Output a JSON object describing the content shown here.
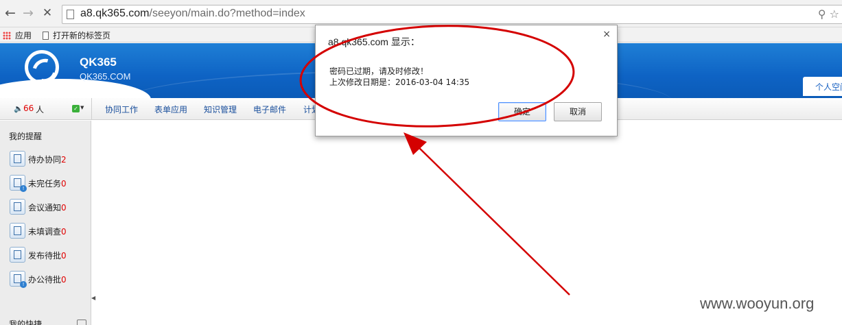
{
  "browser": {
    "url_host": "a8.qk365.com",
    "url_path": "/seeyon/main.do?method=index",
    "bookmarks": [
      {
        "label": "应用"
      },
      {
        "label": "打开新的标签页"
      }
    ]
  },
  "header": {
    "brand_name": "QK365",
    "brand_domain": "QK365.COM",
    "personal_tab": "个人空间"
  },
  "menubar": {
    "online_count": "66",
    "online_unit": "人",
    "items": [
      "协同工作",
      "表单应用",
      "知识管理",
      "电子邮件",
      "计划"
    ]
  },
  "sidebar": {
    "title": "我的提醒",
    "items": [
      {
        "label": "待办协同",
        "count": "2",
        "icon": "pending-collab-icon"
      },
      {
        "label": "未完任务",
        "count": "0",
        "icon": "unfinished-task-icon"
      },
      {
        "label": "会议通知",
        "count": "0",
        "icon": "meeting-notice-icon"
      },
      {
        "label": "未填调查",
        "count": "0",
        "icon": "survey-icon"
      },
      {
        "label": "发布待批",
        "count": "0",
        "icon": "publish-approve-icon"
      },
      {
        "label": "办公待批",
        "count": "0",
        "icon": "office-approve-icon"
      }
    ],
    "shortcut_title": "我的快捷"
  },
  "dialog": {
    "title": "a8.qk365.com 显示：",
    "message_line1": "密码已过期，请及时修改！",
    "message_line2": "上次修改日期是：2016-03-04 14:35",
    "ok_label": "确定",
    "cancel_label": "取消",
    "close_glyph": "×"
  },
  "annotation": {
    "color": "#d40000",
    "watermark": "www.wooyun.org"
  }
}
